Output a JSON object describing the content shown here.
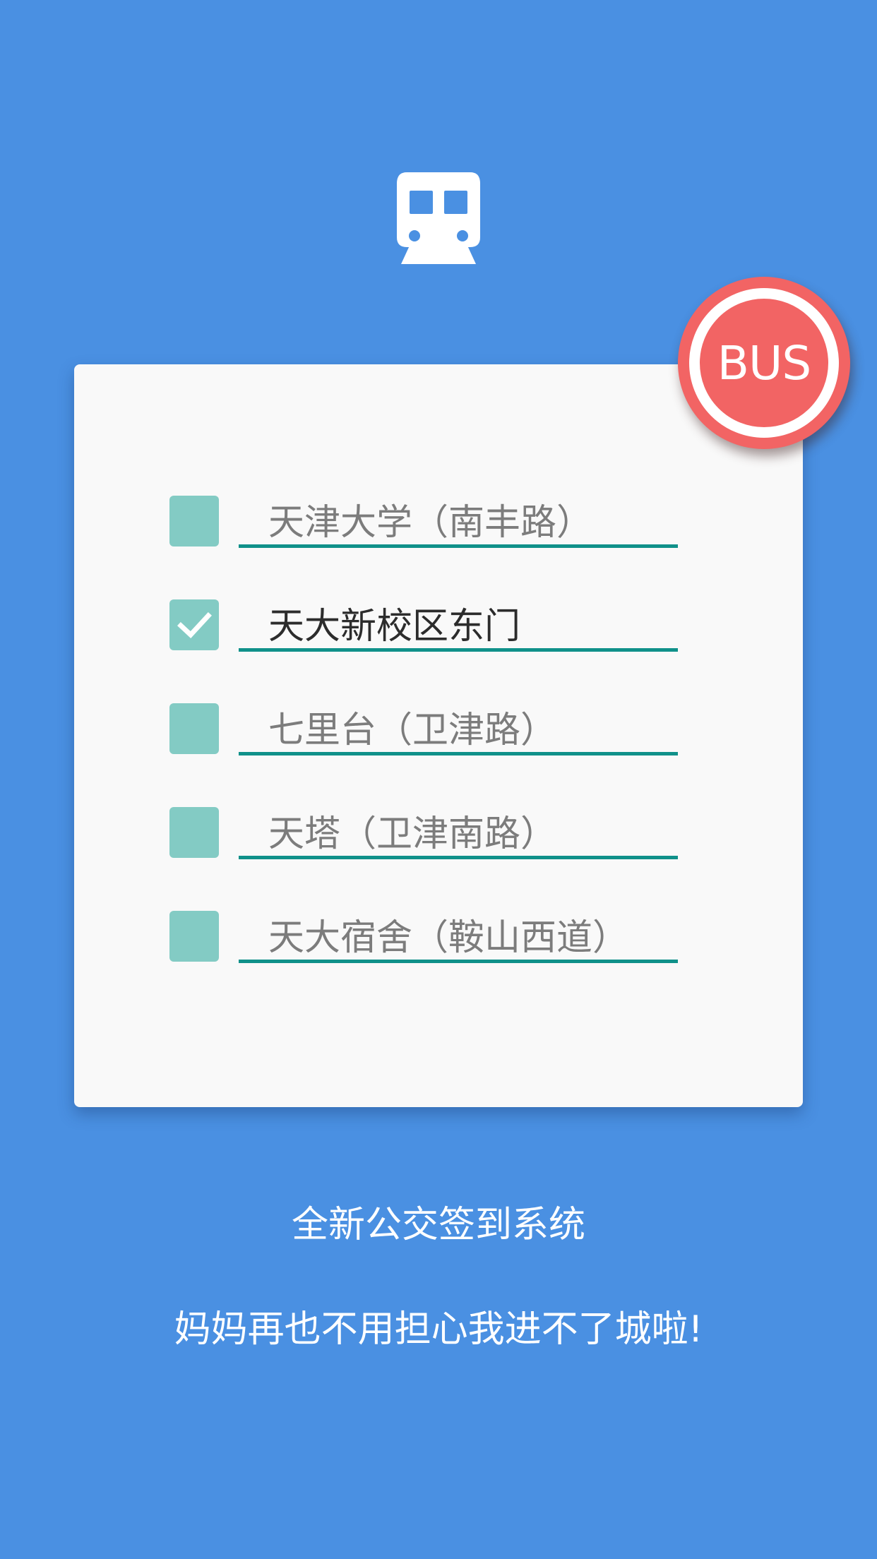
{
  "app": {
    "header_icon": "train-icon",
    "badge_text": "BUS"
  },
  "stops": [
    {
      "label": "天津大学（南丰路）",
      "checked": false
    },
    {
      "label": "天大新校区东门",
      "checked": true
    },
    {
      "label": "七里台（卫津路）",
      "checked": false
    },
    {
      "label": "天塔（卫津南路）",
      "checked": false
    },
    {
      "label": "天大宿舍（鞍山西道）",
      "checked": false
    }
  ],
  "tagline": {
    "line1": "全新公交签到系统",
    "line2": "妈妈再也不用担心我进不了城啦!"
  },
  "colors": {
    "background": "#4a90e2",
    "card": "#f9f9f9",
    "checkbox": "#83cbc4",
    "underline": "#10918a",
    "badge": "#f26464"
  }
}
